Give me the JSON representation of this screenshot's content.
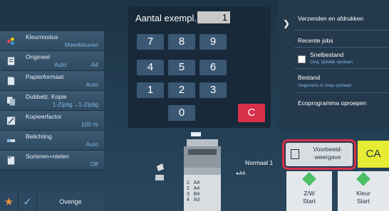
{
  "left_settings": [
    {
      "label": "Kleurmodus",
      "value": "Meerkleuren",
      "icon": "color-mode-icon"
    },
    {
      "label": "Origineel",
      "value_left": "Auto",
      "value_right": "A4",
      "icon": "original-icon"
    },
    {
      "label": "Papierformaat",
      "value": "Auto",
      "icon": "paper-size-icon"
    },
    {
      "label": "Dubbelz. Kopie",
      "value": "1-Zijdig→1-Zijdig",
      "icon": "duplex-icon"
    },
    {
      "label": "Kopieerfactor",
      "value": "100 %",
      "icon": "zoom-icon"
    },
    {
      "label": "Belichting",
      "value": "Auto",
      "icon": "exposure-icon"
    },
    {
      "label": "Sorteren+nieten",
      "value": "Off",
      "icon": "sort-staple-icon"
    }
  ],
  "bottom_bar": {
    "other_label": "Overige"
  },
  "keypad": {
    "label": "Aantal exempl.",
    "value": "1",
    "keys": [
      "7",
      "8",
      "9",
      "4",
      "5",
      "6",
      "1",
      "2",
      "3",
      "0"
    ],
    "clear": "C"
  },
  "right_panel": {
    "title": "Verzenden en afdrukken",
    "recent_jobs": "Recente jobs",
    "quick_file": "Snelbestand",
    "quick_file_sub": "Geg. tijdelijk opslaan",
    "file": "Bestand",
    "file_sub": "Gegevens in map opslaan",
    "eco": "Ecoprogramma oproepen"
  },
  "machine": {
    "output_label": "Normaal 1",
    "output_size": "A4",
    "trays": [
      {
        "num": "1",
        "size": "A4"
      },
      {
        "num": "2",
        "size": "A4"
      },
      {
        "num": "3",
        "size": "B4"
      },
      {
        "num": "4",
        "size": "A3"
      }
    ]
  },
  "preview": {
    "line1": "Voorbeeld-",
    "line2": "weergave"
  },
  "ca": "CA",
  "start_bw": {
    "line1": "Z/W",
    "line2": "Start"
  },
  "start_color": {
    "line1": "Kleur",
    "line2": "Start"
  },
  "colors": {
    "accent_red": "#d9304a",
    "ca_yellow": "#e6eb33",
    "start_green": "#4cbf67",
    "value_blue": "#7fb6e6"
  }
}
